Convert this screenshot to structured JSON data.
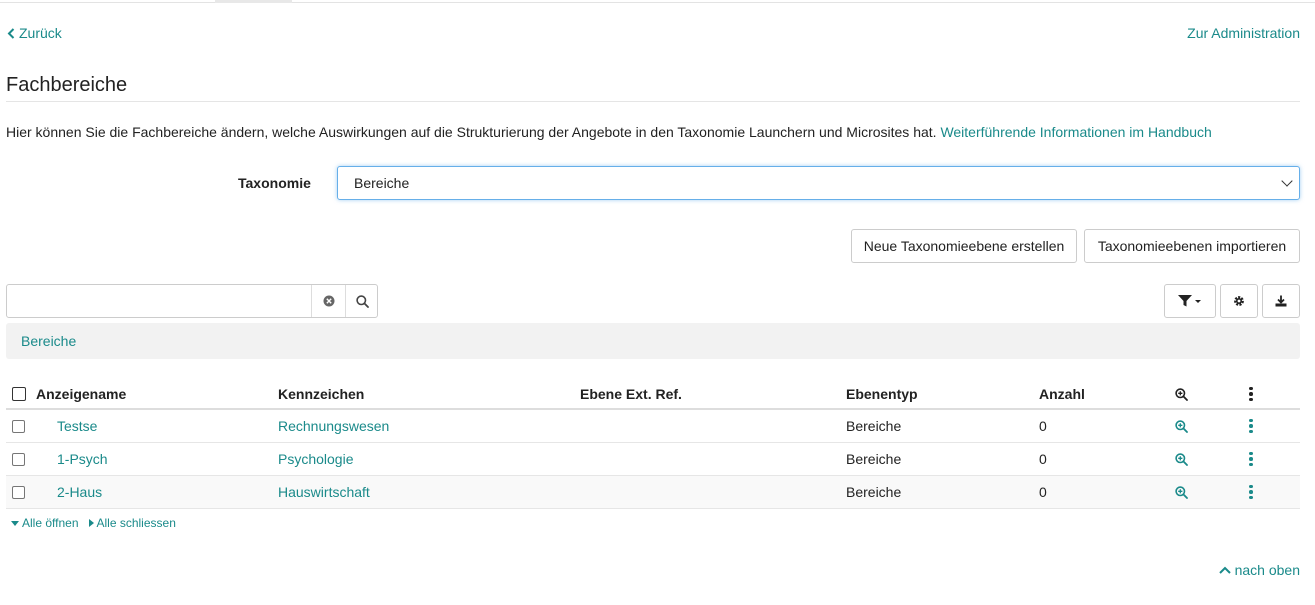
{
  "nav": {
    "back_label": "Zurück",
    "admin_label": "Zur Administration"
  },
  "page": {
    "title": "Fachbereiche",
    "intro_text": "Hier können Sie die Fachbereiche ändern, welche Auswirkungen auf die Strukturierung der Angebote in den Taxonomie Launchern und Microsites hat. ",
    "intro_link": "Weiterführende Informationen im Handbuch"
  },
  "taxonomy": {
    "label": "Taxonomie",
    "selected": "Bereiche"
  },
  "actions": {
    "new_label": "Neue Taxonomieebene erstellen",
    "import_label": "Taxonomieebenen importieren"
  },
  "search": {
    "value": "",
    "placeholder": ""
  },
  "breadcrumb": {
    "label": "Bereiche"
  },
  "table": {
    "headers": {
      "name": "Anzeigename",
      "kennzeichen": "Kennzeichen",
      "ref": "Ebene Ext. Ref.",
      "typ": "Ebenentyp",
      "anzahl": "Anzahl"
    },
    "rows": [
      {
        "name": "Testse",
        "kennzeichen": "Rechnungswesen",
        "ref": "",
        "typ": "Bereiche",
        "anzahl": "0"
      },
      {
        "name": "1-Psych",
        "kennzeichen": "Psychologie",
        "ref": "",
        "typ": "Bereiche",
        "anzahl": "0"
      },
      {
        "name": "2-Haus",
        "kennzeichen": "Hauswirtschaft",
        "ref": "",
        "typ": "Bereiche",
        "anzahl": "0"
      }
    ]
  },
  "tree": {
    "open_all": "Alle öffnen",
    "close_all": "Alle schliessen"
  },
  "footer": {
    "to_top": "nach oben"
  },
  "colors": {
    "accent": "#1a8a8a",
    "focus": "#66afe9"
  }
}
